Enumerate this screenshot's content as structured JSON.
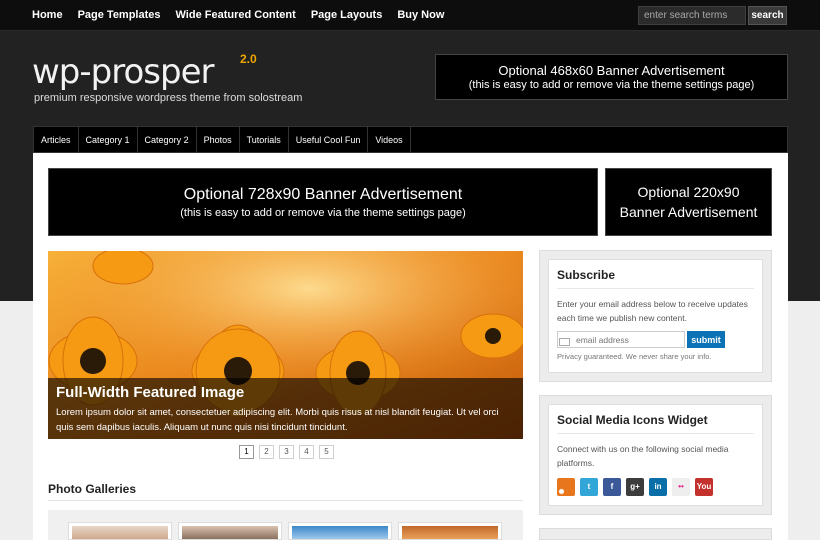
{
  "topnav": [
    "Home",
    "Page Templates",
    "Wide Featured Content",
    "Page Layouts",
    "Buy Now"
  ],
  "search": {
    "placeholder": "enter search terms",
    "button": "search"
  },
  "logo": {
    "text": "wp-prosper",
    "version": "2.0",
    "tagline": "premium responsive wordpress theme from solostream"
  },
  "banner468": {
    "line1": "Optional 468x60 Banner Advertisement",
    "line2": "(this is easy to add or remove via the theme settings page)"
  },
  "catnav": [
    "Articles",
    "Category 1",
    "Category 2",
    "Photos",
    "Tutorials",
    "Useful Cool Fun",
    "Videos"
  ],
  "banner728": {
    "line1": "Optional 728x90 Banner Advertisement",
    "line2": "(this is easy to add or remove via the theme settings page)"
  },
  "banner220": {
    "line1": "Optional 220x90",
    "line2": "Banner Advertisement"
  },
  "featured": {
    "title": "Full-Width Featured Image",
    "text": "Lorem ipsum dolor sit amet, consectetuer adipiscing elit. Morbi quis risus at nisl blandit feugiat. Ut vel orci quis sem dapibus iaculis. Aliquam ut nunc quis nisi tincidunt tincidunt."
  },
  "pager": [
    "1",
    "2",
    "3",
    "4",
    "5"
  ],
  "photo_galleries": {
    "title": "Photo Galleries"
  },
  "subscribe": {
    "title": "Subscribe",
    "text": "Enter your email address below to receive updates each time we publish new content.",
    "placeholder": "email address",
    "button": "submit",
    "privacy": "Privacy guaranteed. We never share your info."
  },
  "social": {
    "title": "Social Media Icons Widget",
    "text": "Connect with us on the following social media platforms.",
    "icons": [
      {
        "name": "rss-icon",
        "glyph": "",
        "color": "#e8761c"
      },
      {
        "name": "twitter-icon",
        "glyph": "t",
        "color": "#33a6d8"
      },
      {
        "name": "facebook-icon",
        "glyph": "f",
        "color": "#3b5998"
      },
      {
        "name": "google-plus-icon",
        "glyph": "g+",
        "color": "#3c3c3c"
      },
      {
        "name": "linkedin-icon",
        "glyph": "in",
        "color": "#0a6fa8"
      },
      {
        "name": "flickr-icon",
        "glyph": "••",
        "color": "#eeeeee"
      },
      {
        "name": "youtube-icon",
        "glyph": "You",
        "color": "#c4302b"
      }
    ]
  },
  "colors": {
    "accent": "#0b73b5",
    "logo_version": "#f0a600",
    "header": "#222222"
  }
}
